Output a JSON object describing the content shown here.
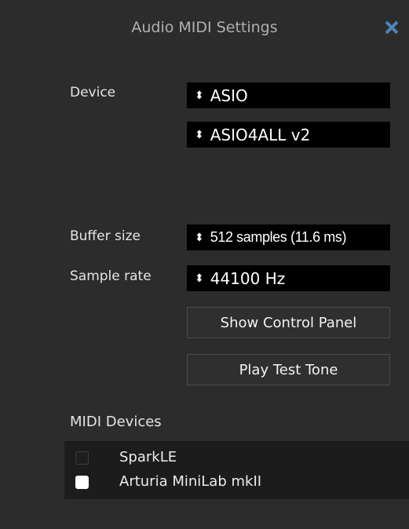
{
  "window": {
    "title": "Audio MIDI Settings",
    "close_icon": "close-icon"
  },
  "audio": {
    "device_label": "Device",
    "device_type": "ASIO",
    "device_name": "ASIO4ALL v2",
    "buffer_label": "Buffer size",
    "buffer_value": "512 samples (11.6 ms)",
    "rate_label": "Sample rate",
    "rate_value": "44100 Hz",
    "select_arrow_glyph": "♦"
  },
  "buttons": {
    "control_panel": "Show Control Panel",
    "test_tone": "Play Test Tone"
  },
  "midi": {
    "title": "MIDI Devices",
    "devices": [
      {
        "name": "SparkLE",
        "enabled": false
      },
      {
        "name": "Arturia MiniLab mkII",
        "enabled": true
      }
    ]
  },
  "colors": {
    "background": "#2c2c2c",
    "select_background": "#000000",
    "list_background": "#1c1c1c",
    "close_icon": "#4d86b8",
    "text": "#ececec"
  }
}
